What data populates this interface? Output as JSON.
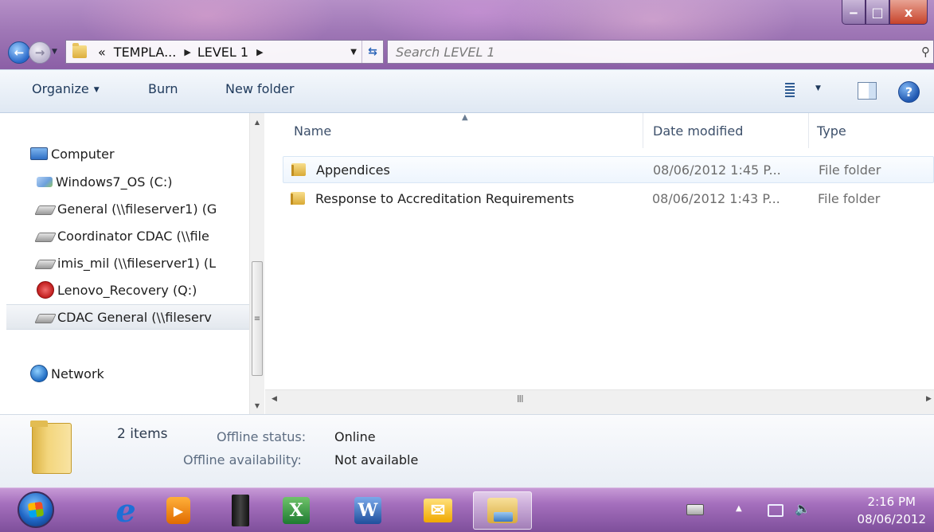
{
  "window": {
    "controls": {
      "minimize": "‒",
      "maximize": "□",
      "close": "x"
    }
  },
  "address": {
    "overflow": "«",
    "crumbs": [
      "TEMPLA...",
      "LEVEL 1"
    ],
    "search_placeholder": "Search LEVEL 1"
  },
  "toolbar": {
    "organize": "Organize",
    "burn": "Burn",
    "new_folder": "New folder"
  },
  "nav": {
    "items": [
      {
        "label": "Computer",
        "icon": "computer-icon"
      },
      {
        "label": "Windows7_OS (C:)",
        "icon": "os-drive-icon"
      },
      {
        "label": "General (\\\\fileserver1) (G",
        "icon": "network-drive-icon"
      },
      {
        "label": "Coordinator CDAC (\\\\file",
        "icon": "network-drive-icon"
      },
      {
        "label": "imis_mil (\\\\fileserver1) (L",
        "icon": "network-drive-icon"
      },
      {
        "label": "Lenovo_Recovery (Q:)",
        "icon": "recovery-drive-icon"
      },
      {
        "label": "CDAC General (\\\\fileserv",
        "icon": "network-drive-icon",
        "selected": true
      },
      {
        "label": "Network",
        "icon": "network-icon"
      }
    ]
  },
  "columns": {
    "name": "Name",
    "date": "Date modified",
    "type": "Type"
  },
  "files": [
    {
      "name": "Appendices",
      "date": "08/06/2012 1:45 P...",
      "type": "File folder"
    },
    {
      "name": "Response to Accreditation Requirements",
      "date": "08/06/2012 1:43 P...",
      "type": "File folder"
    }
  ],
  "details": {
    "count": "2 items",
    "status_label": "Offline status:",
    "status_value": "Online",
    "availability_label": "Offline availability:",
    "availability_value": "Not available"
  },
  "taskbar": {
    "apps": [
      "internet-explorer",
      "media-player",
      "computer-tower",
      "excel",
      "word",
      "outlook",
      "windows-explorer"
    ],
    "active_app": "windows-explorer",
    "clock_time": "2:16 PM",
    "clock_date": "08/06/2012"
  }
}
